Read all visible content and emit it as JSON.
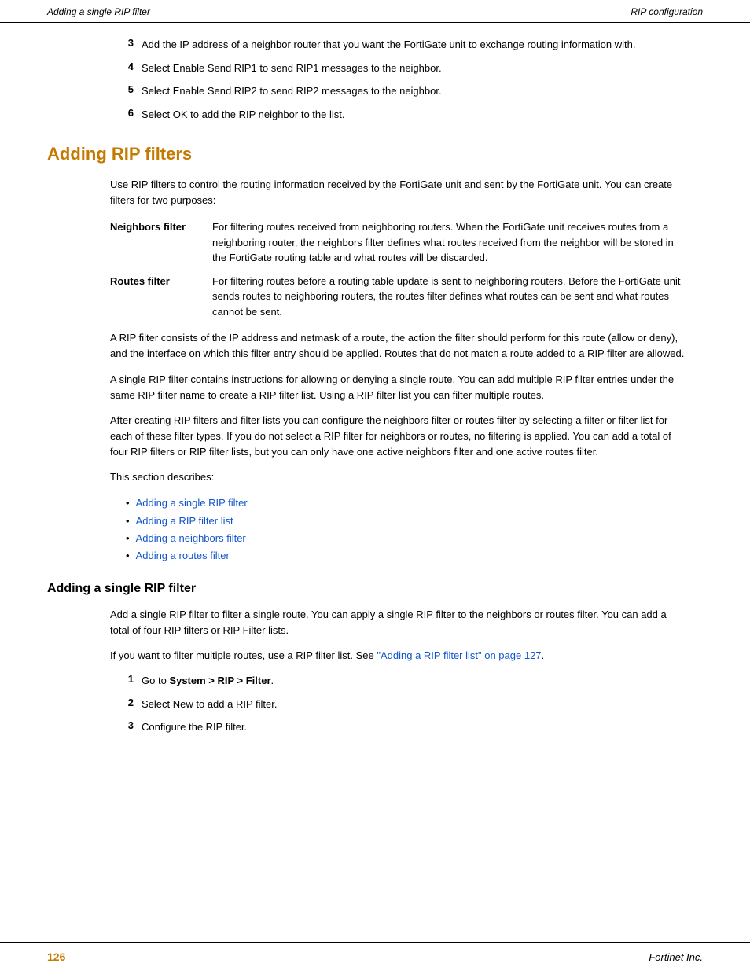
{
  "header": {
    "left": "Adding a single RIP filter",
    "right": "RIP configuration"
  },
  "intro_items": [
    {
      "num": "3",
      "text": "Add the IP address of a neighbor router that you want the FortiGate unit to exchange routing information with."
    },
    {
      "num": "4",
      "text": "Select Enable Send RIP1 to send RIP1 messages to the neighbor."
    },
    {
      "num": "5",
      "text": "Select Enable Send RIP2 to send RIP2 messages to the neighbor."
    },
    {
      "num": "6",
      "text": "Select OK to add the RIP neighbor to the list."
    }
  ],
  "main_section": {
    "title": "Adding RIP filters",
    "intro_para": "Use RIP filters to control the routing information received by the FortiGate unit and sent by the FortiGate unit. You can create filters for two purposes:",
    "definitions": [
      {
        "term": "Neighbors filter",
        "desc": "For filtering routes received from neighboring routers. When the FortiGate unit receives routes from a neighboring router, the neighbors filter defines what routes received from the neighbor will be stored in the FortiGate routing table and what routes will be discarded."
      },
      {
        "term": "Routes filter",
        "desc": "For filtering routes before a routing table update is sent to neighboring routers. Before the FortiGate unit sends routes to neighboring routers, the routes filter defines what routes can be sent and what routes cannot be sent."
      }
    ],
    "para1": "A RIP filter consists of the IP address and netmask of a route, the action the filter should perform for this route (allow or deny), and the interface on which this filter entry should be applied. Routes that do not match a route added to a RIP filter are allowed.",
    "para2": "A single RIP filter contains instructions for allowing or denying a single route. You can add multiple RIP filter entries under the same RIP filter name to create a RIP filter list. Using a RIP filter list you can filter multiple routes.",
    "para3": "After creating RIP filters and filter lists you can configure the neighbors filter or routes filter by selecting a filter or filter list for each of these filter types. If you do not select a RIP filter for neighbors or routes, no filtering is applied. You can add a total of four RIP filters or RIP filter lists, but you can only have one active neighbors filter and one active routes filter.",
    "para4": "This section describes:",
    "links": [
      {
        "text": "Adding a single RIP filter",
        "href": "#single-rip-filter"
      },
      {
        "text": "Adding a RIP filter list",
        "href": "#rip-filter-list"
      },
      {
        "text": "Adding a neighbors filter",
        "href": "#neighbors-filter"
      },
      {
        "text": "Adding a routes filter",
        "href": "#routes-filter"
      }
    ]
  },
  "sub_section": {
    "title": "Adding a single RIP filter",
    "para1": "Add a single RIP filter to filter a single route. You can apply a single RIP filter to the neighbors or routes filter. You can add a total of four RIP filters or RIP Filter lists.",
    "para2_prefix": "If you want to filter multiple routes, use a RIP filter list. See ",
    "para2_link": "\"Adding a RIP filter list\" on page 127",
    "para2_suffix": ".",
    "steps": [
      {
        "num": "1",
        "text_prefix": "Go to ",
        "text_bold": "System > RIP > Filter",
        "text_suffix": "."
      },
      {
        "num": "2",
        "text": "Select New to add a RIP filter."
      },
      {
        "num": "3",
        "text": "Configure the RIP filter."
      }
    ]
  },
  "footer": {
    "page_num": "126",
    "company": "Fortinet Inc."
  }
}
